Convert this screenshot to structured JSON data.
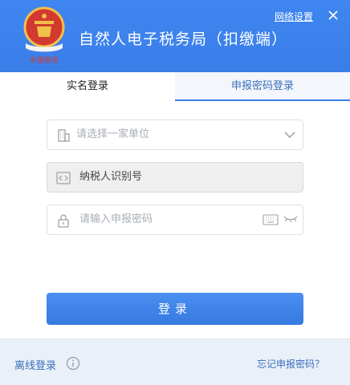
{
  "header": {
    "title": "自然人电子税务局（扣缴端）",
    "network_settings": "网络设置",
    "close_icon": "close-icon",
    "emblem_icon": "tax-emblem-icon",
    "background_color": "#3a7ee8"
  },
  "tabs": [
    {
      "label": "实名登录",
      "active": false
    },
    {
      "label": "申报密码登录",
      "active": true
    }
  ],
  "form": {
    "company": {
      "placeholder": "请选择一家单位",
      "icon": "building-icon",
      "value": ""
    },
    "taxpayer_id": {
      "value": "纳税人识别号",
      "icon": "code-icon"
    },
    "password": {
      "placeholder": "请输入申报密码",
      "icon": "lock-icon",
      "keyboard_icon": "keyboard-icon",
      "visibility_icon": "eye-closed-icon"
    },
    "login_label": "登录"
  },
  "footer": {
    "offline_login": "离线登录",
    "info_icon": "info-icon",
    "forgot_password": "忘记申报密码？"
  },
  "colors": {
    "primary": "#3a7ee8",
    "link": "#3a6fbd",
    "footer_bg": "#e9f0f8"
  }
}
